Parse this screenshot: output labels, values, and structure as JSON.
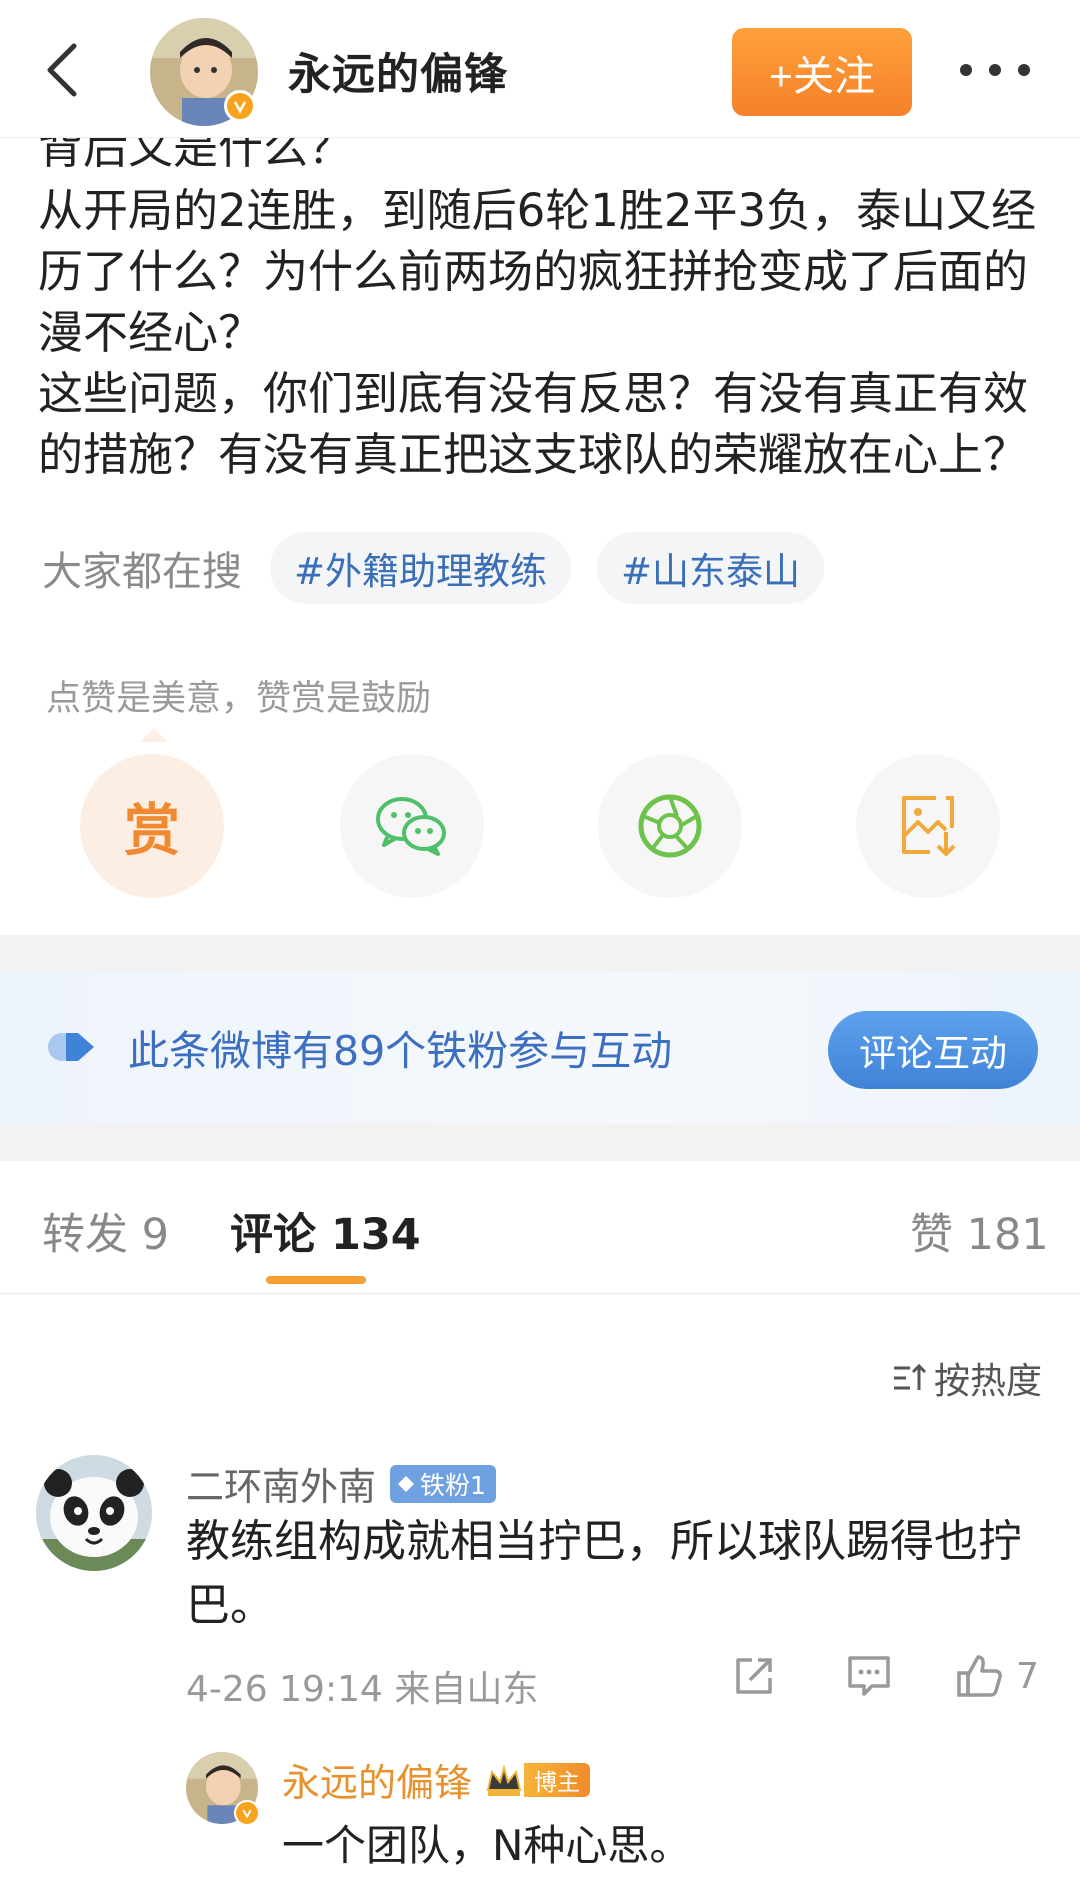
{
  "header": {
    "username": "永远的偏锋",
    "follow_label": "+关注"
  },
  "post": {
    "cut_line": "背后又是什么？",
    "lines": [
      "从开局的2连胜，到随后6轮1胜2平3负，泰山又经",
      "历了什么？为什么前两场的疯狂拼抢变成了后面的",
      "漫不经心？",
      "这些问题，你们到底有没有反思？有没有真正有效",
      "的措施？有没有真正把这支球队的荣耀放在心上？"
    ]
  },
  "search": {
    "label": "大家都在搜",
    "tags": [
      "#外籍助理教练",
      "#山东泰山"
    ]
  },
  "reward": {
    "tip": "点赞是美意，赞赏是鼓励",
    "reward_char": "赏"
  },
  "fan_banner": {
    "text": "此条微博有89个铁粉参与互动",
    "button": "评论互动"
  },
  "tabs": {
    "repost": "转发 9",
    "comments": "评论 134",
    "likes": "赞 181"
  },
  "sort_label": "按热度",
  "comment": {
    "username": "二环南外南",
    "badge": "铁粉1",
    "text_line1": "教练组构成就相当拧巴，所以球队踢得也拧",
    "text_line2": "巴。",
    "meta": "4-26 19:14 来自山东",
    "like_count": "7"
  },
  "reply": {
    "username": "永远的偏锋",
    "badge": "博主",
    "text": "一个团队，N种心思。"
  },
  "colors": {
    "accent_orange": "#f5812a",
    "link_blue": "#3a6fb8",
    "fan_blue": "#3f83d8"
  }
}
